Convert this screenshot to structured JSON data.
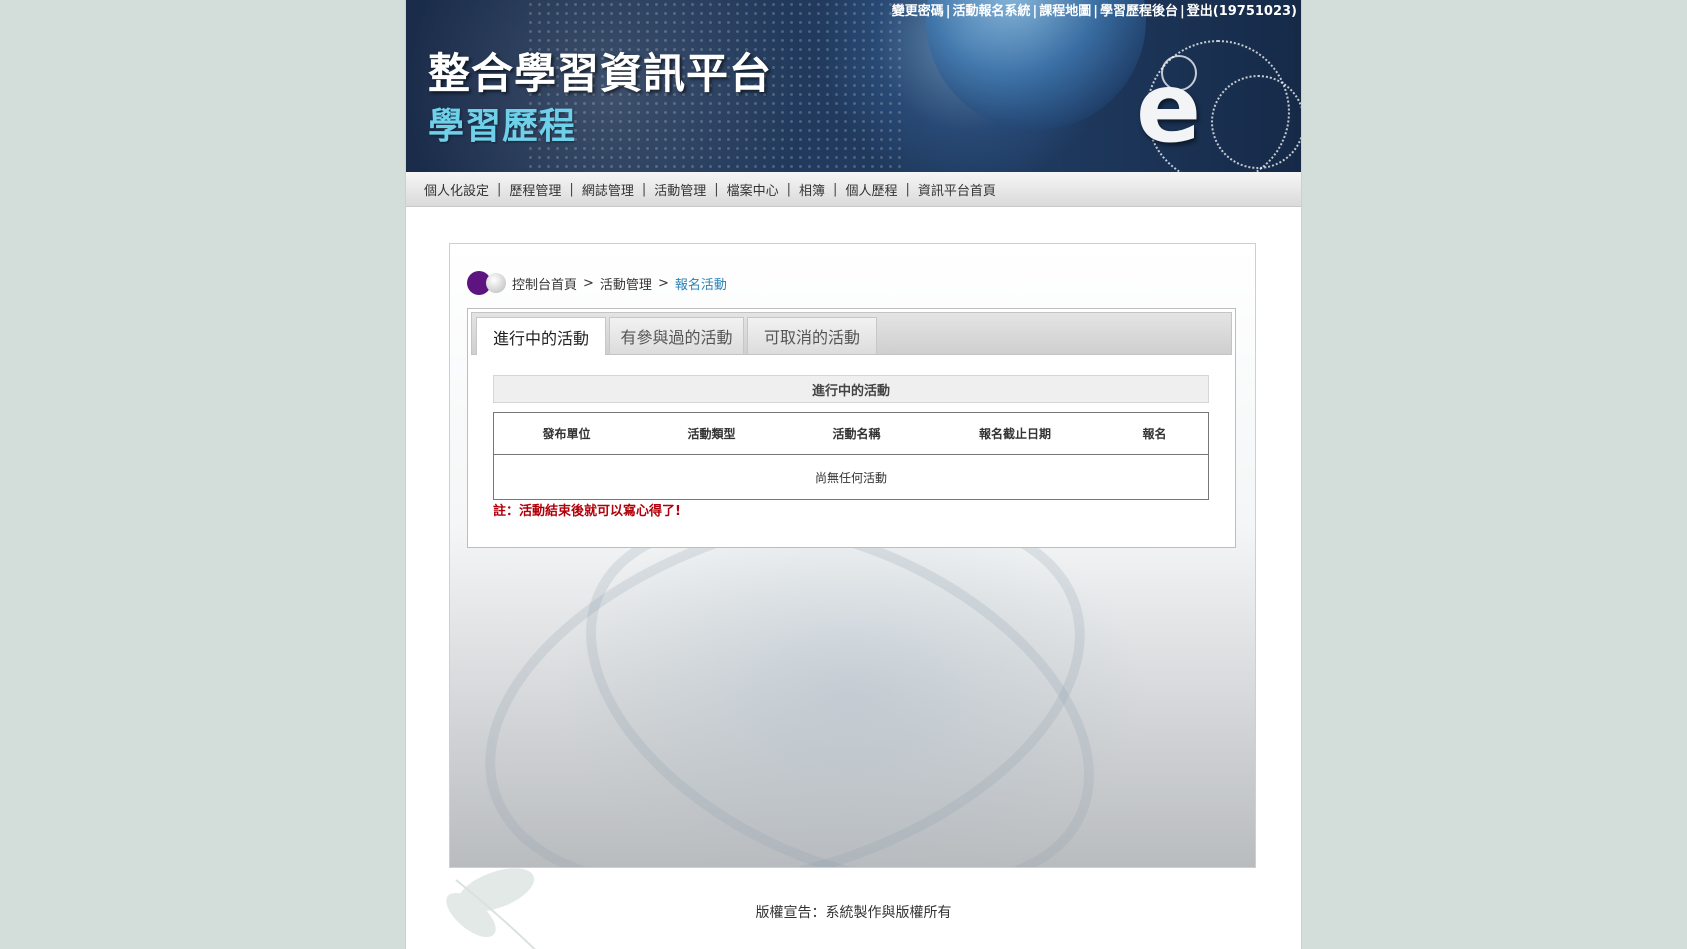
{
  "header": {
    "title": "整合學習資訊平台",
    "subtitle": "學習歷程",
    "logo_letter": "e",
    "top_links": [
      {
        "label": "變更密碼"
      },
      {
        "label": "活動報名系統"
      },
      {
        "label": "課程地圖"
      },
      {
        "label": "學習歷程後台"
      },
      {
        "label": "登出(19751023)"
      }
    ]
  },
  "nav": {
    "items": [
      {
        "label": "個人化設定"
      },
      {
        "label": "歷程管理"
      },
      {
        "label": "網誌管理"
      },
      {
        "label": "活動管理"
      },
      {
        "label": "檔案中心"
      },
      {
        "label": "相簿"
      },
      {
        "label": "個人歷程"
      },
      {
        "label": "資訊平台首頁"
      }
    ],
    "separator": "|"
  },
  "breadcrumb": {
    "items": [
      "控制台首頁",
      "活動管理"
    ],
    "current": "報名活動",
    "separator": ">"
  },
  "tabs": [
    {
      "label": "進行中的活動",
      "active": true
    },
    {
      "label": "有參與過的活動",
      "active": false
    },
    {
      "label": "可取消的活動",
      "active": false
    }
  ],
  "section": {
    "title": "進行中的活動",
    "table": {
      "columns": [
        "發布單位",
        "活動類型",
        "活動名稱",
        "報名截止日期",
        "報名"
      ],
      "empty_message": "尚無任何活動"
    },
    "note": "註：活動結束後就可以寫心得了!"
  },
  "footer": {
    "text": "版權宣告：系統製作與版權所有"
  },
  "colors": {
    "background": "#d3ddd9",
    "breadcrumb_current": "#2a82b8",
    "note": "#b0000a",
    "breadcrumb_ball": "#5d1480",
    "subtitle": "#6fd0ea"
  }
}
